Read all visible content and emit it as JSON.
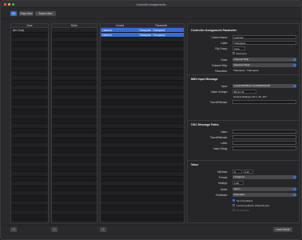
{
  "window": {
    "title": "Controller Assignments"
  },
  "toolbar": {
    "view_toggle": "On",
    "easy_view": "Easy View",
    "expert_view": "Expert View"
  },
  "zones": {
    "header": "Zone",
    "items": [
      "(No Zone)"
    ]
  },
  "modes": {
    "header": "Mode"
  },
  "assignments": {
    "control_header": "Control",
    "parameter_header": "Parameter",
    "rows": [
      {
        "control": "Learned",
        "parameter": "Transpose : Transpose"
      },
      {
        "control": "Learned",
        "parameter": "Transpose : Transpose"
      }
    ]
  },
  "inspector": {
    "controller_section": "Controller Assignment Parameter",
    "control_name_label": "Control Name:",
    "control_name_value": "Learned",
    "label_label": "Label:",
    "label_value": "Transpose",
    "flip_group_label": "Flip Group:",
    "flip_group_value": "none",
    "exclusive_label": "Exclusive",
    "class_label": "Class:",
    "class_value": "Channel Strip",
    "channel_strip_label": "Channel Strip:",
    "channel_strip_value": "Selected Track",
    "parameter_label": "Parameter:",
    "parameter_value": "Transpose : Transpose",
    "midi_section": "MIDI Input Message",
    "input_label": "Input:",
    "input_value": "nanoKONTROL2 SLIDER/KNOB",
    "value_change_label": "Value Change:",
    "value_change_value": "B0 21 7F",
    "value_change_desc": "Control Change CH 1, 33, 127",
    "touch_release_label": "Touch/Release:",
    "osc_section": "OSC Message Paths",
    "osc_value_label": "Value:",
    "osc_touch_label": "Touch/Release:",
    "osc_label_label": "Label:",
    "osc_value_string_label": "Value String:",
    "value_section": "Value",
    "minmax_label": "Min/Max:",
    "min_value": "0",
    "max_value": "127",
    "format_label": "Format:",
    "format_value": "Unsigned",
    "multiply_label": "Multiply:",
    "multiply_value": "1.00",
    "mode_label": "Mode:",
    "mode_value": "Direct",
    "feedback_label": "Feedback:",
    "feedback_value": "Automatic",
    "text_feedback": "Text Feedback",
    "local_feedback": "Local Feedback (Fader/Knob)",
    "no_restore": "No Restore"
  },
  "bottom": {
    "learn_mode": "Learn Mode"
  }
}
